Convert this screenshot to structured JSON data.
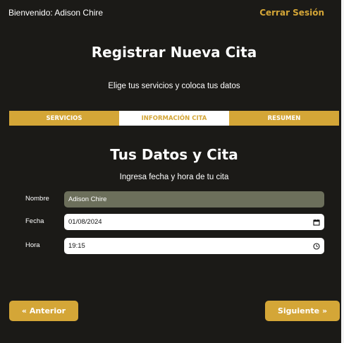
{
  "header": {
    "welcome": "Bienvenido: Adison Chire",
    "logout_label": "Cerrar Sesión"
  },
  "page": {
    "title": "Registrar Nueva Cita",
    "subtitle": "Elige tus servicios y coloca tus datos"
  },
  "tabs": [
    {
      "label": "SERVICIOS",
      "active": false
    },
    {
      "label": "INFORMACIÓN CITA",
      "active": true
    },
    {
      "label": "RESUMEN",
      "active": false
    }
  ],
  "section": {
    "title": "Tus Datos y Cita",
    "subtitle": "Ingresa fecha y hora de tu cita"
  },
  "form": {
    "name": {
      "label": "Nombre",
      "value": "Adison Chire"
    },
    "date": {
      "label": "Fecha",
      "value": "01/08/2024",
      "icon": "calendar-icon"
    },
    "time": {
      "label": "Hora",
      "value": "19:15",
      "icon": "clock-icon"
    }
  },
  "nav": {
    "prev_label": "« Anterior",
    "next_label": "Siguiente »"
  },
  "colors": {
    "background": "#1b1a17",
    "accent": "#d4a637",
    "disabled_field": "#6c6f5b"
  }
}
